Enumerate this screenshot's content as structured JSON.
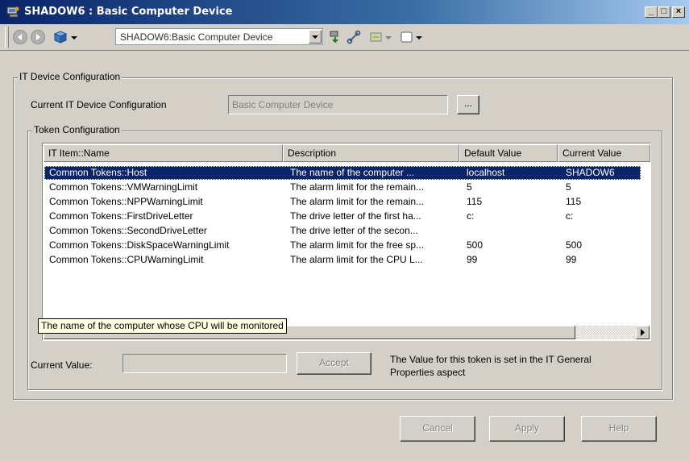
{
  "window": {
    "title": "SHADOW6 : Basic Computer Device",
    "controls": [
      "minimize",
      "maximize",
      "close"
    ]
  },
  "toolbar": {
    "object_selector_value": "SHADOW6:Basic Computer Device"
  },
  "it_device_config": {
    "group_label": "IT Device Configuration",
    "current_label": "Current IT Device Configuration",
    "current_value": "Basic Computer Device",
    "browse_label": "..."
  },
  "token_config": {
    "group_label": "Token Configuration",
    "columns": [
      "IT Item::Name",
      "Description",
      "Default Value",
      "Current Value"
    ],
    "rows": [
      {
        "name": "Common Tokens::Host",
        "description": "The name of the  computer ...",
        "default": "localhost",
        "current": "SHADOW6",
        "selected": true
      },
      {
        "name": "Common Tokens::VMWarningLimit",
        "description": "The alarm limit for the remain...",
        "default": "5",
        "current": "5",
        "selected": false
      },
      {
        "name": "Common Tokens::NPPWarningLimit",
        "description": "The alarm limit for the remain...",
        "default": "115",
        "current": "115",
        "selected": false
      },
      {
        "name": "Common Tokens::FirstDriveLetter",
        "description": "The drive letter of the first ha...",
        "default": "c:",
        "current": "c:",
        "selected": false
      },
      {
        "name": "Common Tokens::SecondDriveLetter",
        "description": "The drive letter of the secon...",
        "default": "",
        "current": "",
        "selected": false
      },
      {
        "name": "Common Tokens::DiskSpaceWarningLimit",
        "description": "The alarm limit for the free sp...",
        "default": "500",
        "current": "500",
        "selected": false
      },
      {
        "name": "Common Tokens::CPUWarningLimit",
        "description": "The alarm limit for the CPU L...",
        "default": "99",
        "current": "99",
        "selected": false
      }
    ],
    "tooltip": "The name of the  computer whose CPU will be monitored",
    "current_value_label": "Current Value:",
    "current_value_input": "",
    "accept_label": "Accept",
    "info_line1": "The Value for this token is set in the IT General",
    "info_line2": "Properties aspect"
  },
  "footer": {
    "cancel_label": "Cancel",
    "apply_label": "Apply",
    "help_label": "Help"
  },
  "colors": {
    "titlebar": "#0a246a",
    "selection": "#0a246a",
    "face": "#d4d0c8",
    "tooltip_bg": "#ffffe1"
  }
}
